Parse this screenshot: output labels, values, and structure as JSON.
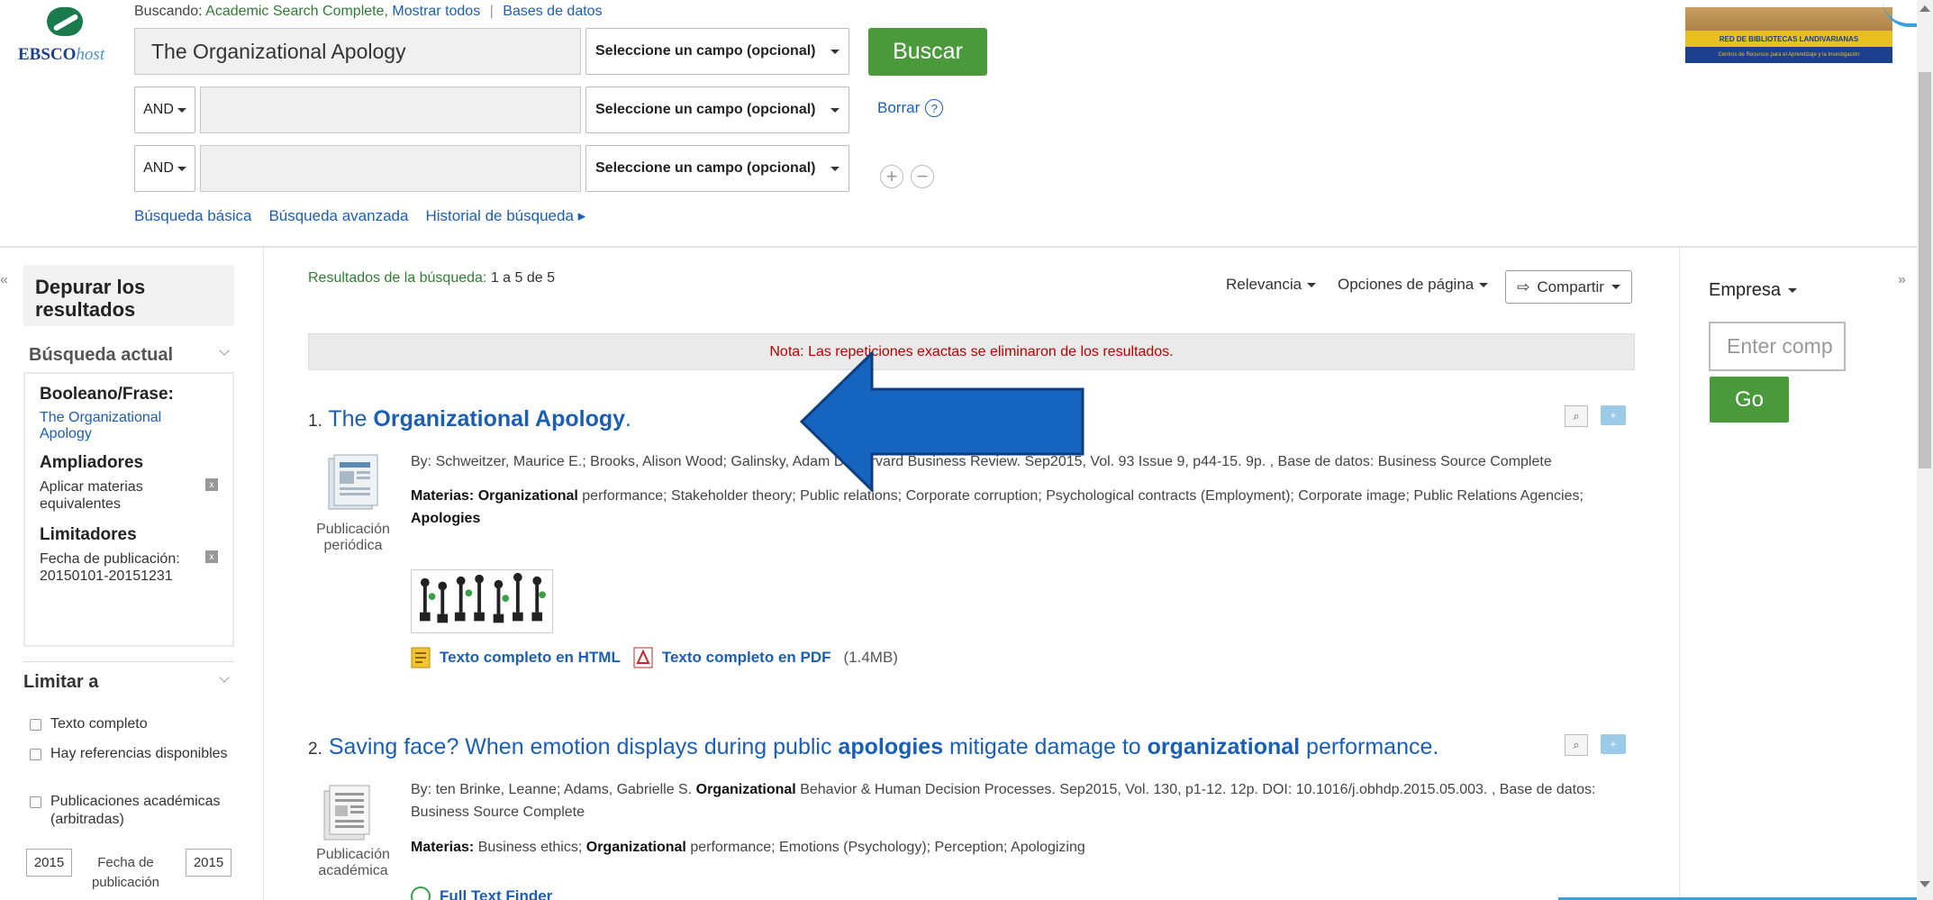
{
  "header": {
    "searching_label": "Buscando:",
    "database": "Academic Search Complete,",
    "show_all": "Mostrar todos",
    "databases_link": "Bases de datos",
    "logo_text_1": "EBSCO",
    "logo_text_2": "host"
  },
  "search": {
    "row1_value": "The Organizational Apology",
    "row2_value": "",
    "row3_value": "",
    "field_placeholder": "Seleccione un campo (opcional)",
    "operator": "AND",
    "search_button": "Buscar",
    "clear": "Borrar",
    "help": "?"
  },
  "nav_links": [
    "Búsqueda básica",
    "Búsqueda avanzada",
    "Historial de búsqueda"
  ],
  "banner": {
    "title": "RED DE BIBLIOTECAS  LANDIVARIANAS",
    "subtitle": "Centros de Recursos para el Aprendizaje y la Investigación"
  },
  "left_panel": {
    "collapse": "«",
    "refine_title": "Depurar los resultados",
    "current_search": "Búsqueda actual",
    "boolean_label": "Booleano/Frase:",
    "boolean_value": "The Organizational Apology",
    "expanders_label": "Ampliadores",
    "expander_item": "Aplicar materias equivalentes",
    "limiters_label": "Limitadores",
    "limiter_item": "Fecha de publicación: 20150101-20151231",
    "limit_to": "Limitar a",
    "checkboxes": [
      "Texto completo",
      "Hay referencias disponibles",
      "Publicaciones académicas (arbitradas)"
    ],
    "year_from": "2015",
    "year_to": "2015",
    "date_label": "Fecha de publicación"
  },
  "results": {
    "count_label": "Resultados de la búsqueda:",
    "count_value": "1 a 5 de 5",
    "sort": "Relevancia",
    "page_options": "Opciones de página",
    "share": "Compartir",
    "note": "Nota: Las repeticiones exactas se eliminaron de los resultados.",
    "items": [
      {
        "num": "1.",
        "title_pre": "The ",
        "title_bold": "Organizational Apology",
        "title_post": ".",
        "byline": "By: Schweitzer, Maurice E.; Brooks, Alison Wood; Galinsky, Adam D. Harvard Business Review. Sep2015, Vol. 93 Issue 9, p44-15. 9p. , Base de datos: Business Source Complete",
        "subjects_label": "Materias:",
        "subjects_bold1": "Organizational",
        "subjects_text": " performance; Stakeholder theory; Public relations; Corporate corruption; Psychological contracts (Employment); Corporate image; Public Relations Agencies; ",
        "subjects_bold2": "Apologies",
        "type": "Publicación periódica",
        "html_link": "Texto completo en HTML",
        "pdf_link": "Texto completo en PDF",
        "pdf_size": "(1.4MB)"
      },
      {
        "num": "2.",
        "title_a": "Saving face? When emotion displays during public ",
        "title_b": "apologies",
        "title_c": " mitigate damage to ",
        "title_d": "organizational",
        "title_e": " performance.",
        "byline_a": "By: ten Brinke, Leanne; Adams, Gabrielle S. ",
        "byline_b": "Organizational",
        "byline_c": " Behavior & Human Decision Processes. Sep2015, Vol. 130, p1-12. 12p. DOI: 10.1016/j.obhdp.2015.05.003. , Base de datos: Business Source Complete",
        "subjects_label": "Materias:",
        "subjects_a": " Business ethics; ",
        "subjects_b": "Organizational",
        "subjects_c": " performance; Emotions (Psychology); Perception; Apologizing",
        "type": "Publicación académica",
        "finder": "Full Text Finder"
      }
    ]
  },
  "right_panel": {
    "company_label": "Empresa",
    "company_placeholder": "Enter comp",
    "go": "Go",
    "collapse": "»"
  },
  "colors": {
    "accent_green": "#4a9a3c",
    "link_blue": "#1a5fb4",
    "arrow_blue": "#1565c0",
    "note_red": "#b00000"
  }
}
